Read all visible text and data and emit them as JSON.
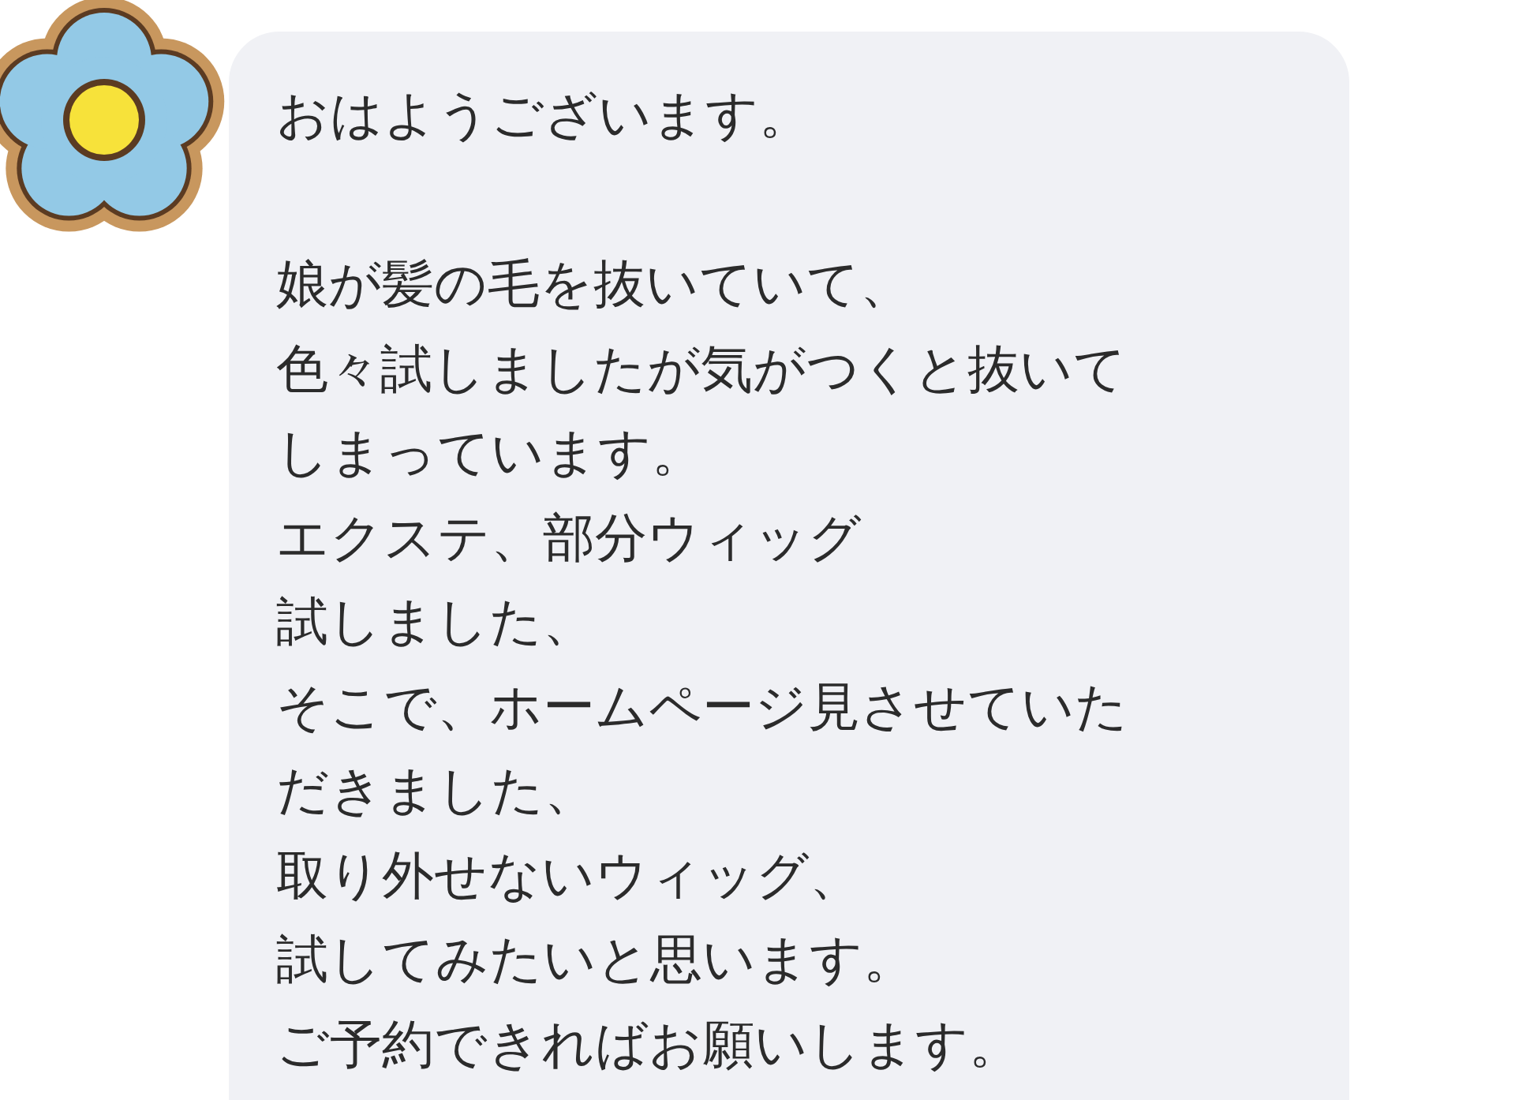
{
  "message": {
    "paragraphs": [
      [
        "おはようございます。"
      ],
      [
        "娘が髪の毛を抜いていて、",
        "色々試しましたが気がつくと抜いて",
        "しまっています。",
        "エクステ、部分ウィッグ",
        "試しました、",
        "そこで、ホームページ見させていた",
        "だきました、",
        "取り外せないウィッグ、",
        "試してみたいと思います。",
        "ご予約できればお願いします。"
      ]
    ]
  }
}
